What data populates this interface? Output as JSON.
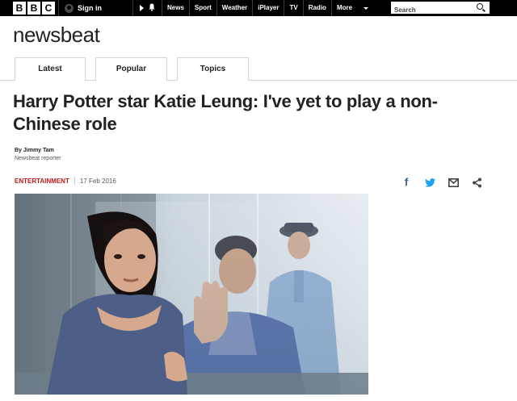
{
  "header": {
    "logo_letters": [
      "B",
      "B",
      "C"
    ],
    "signin_label": "Sign in",
    "nav_items": [
      "News",
      "Sport",
      "Weather",
      "iPlayer",
      "TV",
      "Radio",
      "More"
    ],
    "search_placeholder": "Search"
  },
  "brand": {
    "title": "newsbeat"
  },
  "tabs": [
    "Latest",
    "Popular",
    "Topics"
  ],
  "article": {
    "headline": "Harry Potter star Katie Leung: I've yet to play a non-Chinese role",
    "author": "By Jimmy Tam",
    "author_role": "Newsbeat reporter",
    "category": "ENTERTAINMENT",
    "date": "17 Feb 2016"
  },
  "share": {
    "icons": [
      "facebook-icon",
      "twitter-icon",
      "email-icon",
      "share-icon"
    ],
    "colors": {
      "facebook": "#3b5998",
      "twitter": "#1da1f2",
      "other": "#444444"
    }
  },
  "colors": {
    "accent": "#bb1919",
    "topbar": "#000000"
  }
}
